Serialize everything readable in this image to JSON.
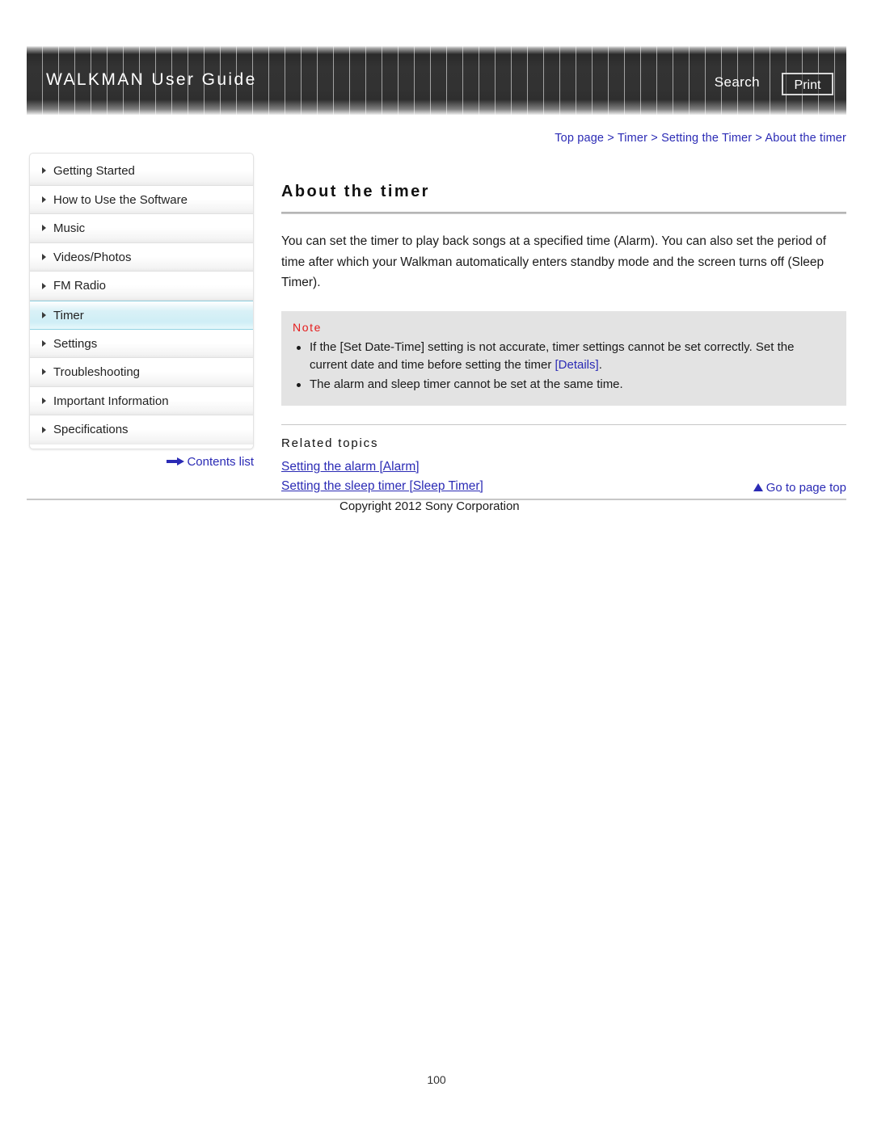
{
  "header": {
    "brand_title": "WALKMAN User Guide",
    "search_label": "Search",
    "print_label": "Print"
  },
  "breadcrumb": {
    "full": "Top page > Timer > Setting the Timer > About the timer",
    "items": [
      "Top page",
      "Timer",
      "Setting the Timer",
      "About the timer"
    ],
    "separator": ">",
    "color": "#2b2bb5"
  },
  "sidebar": {
    "items": [
      {
        "label": "Getting Started",
        "selected": false
      },
      {
        "label": "How to Use the Software",
        "selected": false
      },
      {
        "label": "Music",
        "selected": false
      },
      {
        "label": "Videos/Photos",
        "selected": false
      },
      {
        "label": "FM Radio",
        "selected": false
      },
      {
        "label": "Timer",
        "selected": true
      },
      {
        "label": "Settings",
        "selected": false
      },
      {
        "label": "Troubleshooting",
        "selected": false
      },
      {
        "label": "Important Information",
        "selected": false
      },
      {
        "label": "Specifications",
        "selected": false
      }
    ],
    "contents_list_label": "Contents list",
    "selected_color": "#cfeef6"
  },
  "main": {
    "title": "About the timer",
    "paragraph": "You can set the timer to play back songs at a specified time (Alarm). You can also set the period of time after which your Walkman automatically enters standby mode and the screen turns off (Sleep Timer).",
    "note": {
      "label": "Note",
      "label_color": "#e51b1b",
      "items": [
        {
          "text_before": "If the [Set Date-Time] setting is not accurate, timer settings cannot be set correctly. Set the current date and time before setting the timer ",
          "link": "[Details]",
          "text_after": "."
        },
        {
          "text_before": "The alarm and sleep timer cannot be set at the same time.",
          "link": "",
          "text_after": ""
        }
      ]
    },
    "related": {
      "heading": "Related topics",
      "links": [
        "Setting the alarm [Alarm]",
        "Setting the sleep timer [Sleep Timer]"
      ]
    }
  },
  "footer": {
    "go_to_top_label": "Go to page top",
    "copyright": "Copyright 2012 Sony Corporation",
    "page_number": "100"
  }
}
